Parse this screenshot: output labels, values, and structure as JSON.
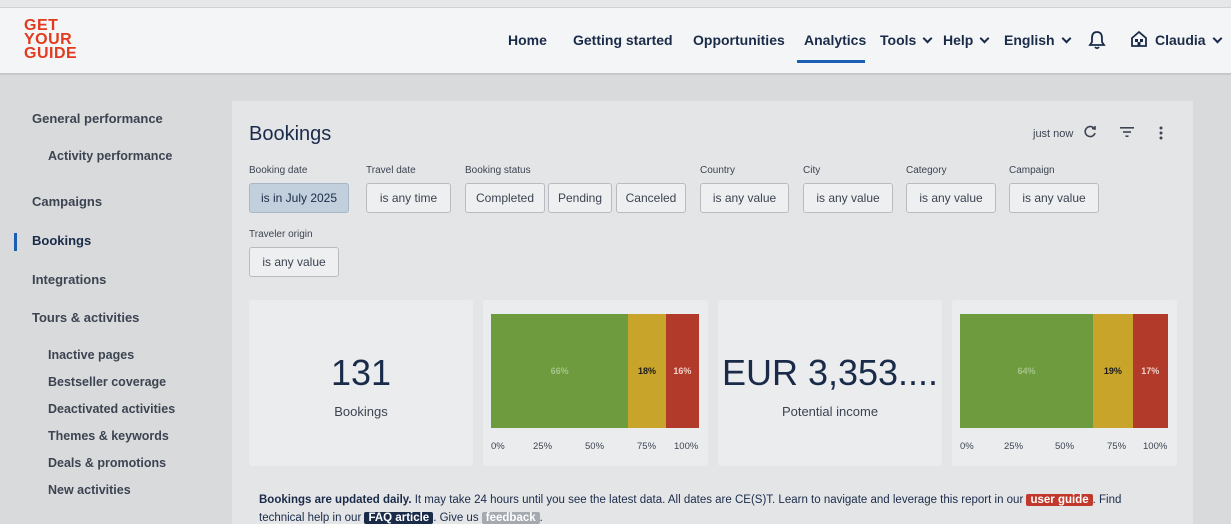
{
  "logo": {
    "lines": [
      "GET",
      "YOUR",
      "GUIDE"
    ]
  },
  "nav": {
    "home": "Home",
    "getting_started": "Getting started",
    "opportunities": "Opportunities",
    "analytics": "Analytics",
    "tools": "Tools",
    "help": "Help",
    "language": "English",
    "user": "Claudia"
  },
  "sidebar": {
    "general_performance": "General performance",
    "activity_performance": "Activity performance",
    "campaigns": "Campaigns",
    "bookings": "Bookings",
    "integrations": "Integrations",
    "tours_activities": "Tours & activities",
    "inactive_pages": "Inactive pages",
    "bestseller_coverage": "Bestseller coverage",
    "deactivated_activities": "Deactivated activities",
    "themes_keywords": "Themes & keywords",
    "deals_promotions": "Deals & promotions",
    "new_activities": "New activities"
  },
  "report": {
    "title": "Bookings",
    "updated": "just now"
  },
  "filters": {
    "booking_date": {
      "label": "Booking date",
      "value": "is in July 2025"
    },
    "travel_date": {
      "label": "Travel date",
      "value": "is any time"
    },
    "booking_status": {
      "label": "Booking status",
      "completed": "Completed",
      "pending": "Pending",
      "canceled": "Canceled"
    },
    "country": {
      "label": "Country",
      "value": "is any value"
    },
    "city": {
      "label": "City",
      "value": "is any value"
    },
    "category": {
      "label": "Category",
      "value": "is any value"
    },
    "campaign": {
      "label": "Campaign",
      "value": "is any value"
    },
    "traveler_origin": {
      "label": "Traveler origin",
      "value": "is any value"
    }
  },
  "cards": {
    "bookings": {
      "value": "131",
      "label": "Bookings"
    },
    "bookings_bar": {
      "completed": "66%",
      "pending": "18%",
      "canceled": "16%",
      "completed_frac": 0.66,
      "pending_frac": 0.18,
      "canceled_frac": 0.16
    },
    "income": {
      "value": "EUR 3,353....",
      "label": "Potential income"
    },
    "income_bar": {
      "completed": "64%",
      "pending": "19%",
      "canceled": "17%",
      "completed_frac": 0.64,
      "pending_frac": 0.19,
      "canceled_frac": 0.17
    },
    "ticks": [
      "0%",
      "25%",
      "50%",
      "75%",
      "100%"
    ]
  },
  "note": {
    "bold": "Bookings are updated daily.",
    "text1": " It may take 24 hours until you see the latest data. All dates are CE(S)T. Learn to navigate and leverage this report in our ",
    "user_guide": "user guide",
    "text2": ". Find technical help in our ",
    "faq": "FAQ article",
    "text3": ". Give us ",
    "feedback": "feedback",
    "text4": "."
  },
  "colors": {
    "accent": "#1b5fb4",
    "brand": "#e23a1e",
    "green": "#6f9b3f",
    "yellow": "#c9a42b",
    "red": "#b23a2b"
  }
}
